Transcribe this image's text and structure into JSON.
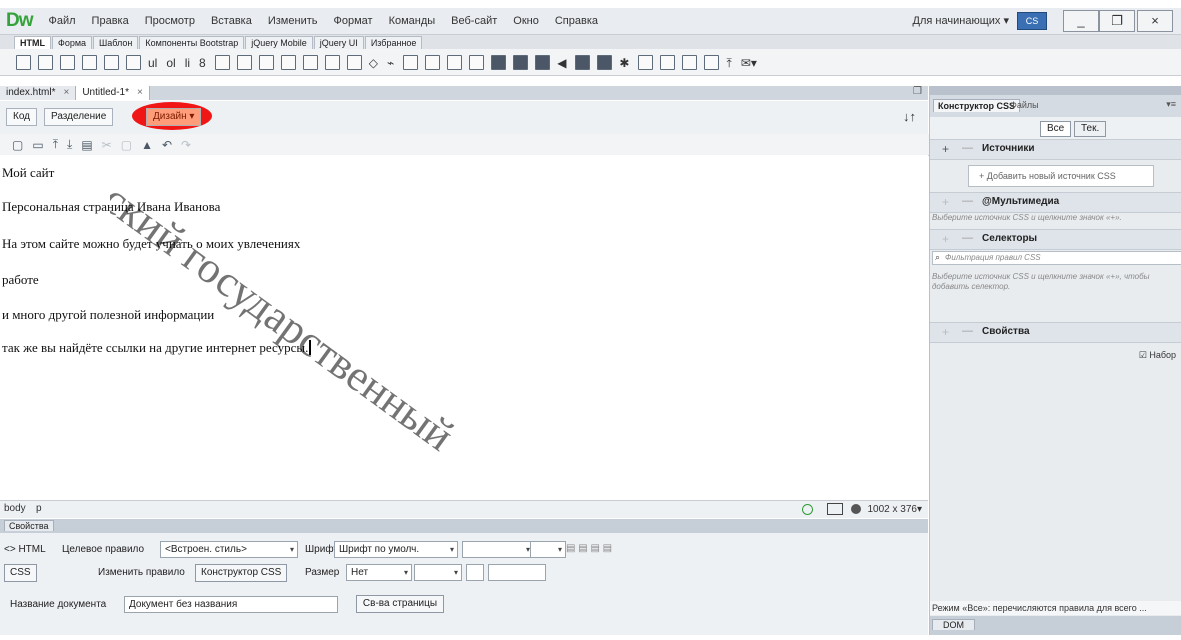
{
  "app": {
    "logo": "Dw",
    "menus": [
      "Файл",
      "Правка",
      "Просмотр",
      "Вставка",
      "Изменить",
      "Формат",
      "Команды",
      "Веб-сайт",
      "Окно",
      "Справка"
    ],
    "workspace": "Для начинающих",
    "cs_label": "CS",
    "window_buttons": [
      "_",
      "ð",
      "×"
    ]
  },
  "insert_tabs": [
    "HTML",
    "Форма",
    "Шаблон",
    "Компоненты Bootstrap",
    "jQuery Mobile",
    "jQuery UI",
    "Избранное"
  ],
  "document_tabs": [
    {
      "label": "index.html*",
      "close": "×"
    },
    {
      "label": "Untitled-1*",
      "close": "×"
    }
  ],
  "view_buttons": {
    "code": "Код",
    "split": "Разделение",
    "design": "Дизайн"
  },
  "canvas_lines": [
    "Мой сайт",
    "Персональная страница Ивана Иванова",
    "На этом сайте можно будет учнать о моих увлечениях",
    "работе",
    "и много другой полезной информации",
    "так же вы найдёте ссылки на другие интернет ресурсы."
  ],
  "status": {
    "tags": [
      "body",
      "p"
    ],
    "size": "1002 x 376"
  },
  "properties": {
    "panel_title": "Свойства",
    "html_btn": "<> HTML",
    "css_btn": "CSS",
    "target_rule_label": "Целевое правило",
    "target_rule_value": "<Встроен. стиль>",
    "edit_rule": "Изменить правило",
    "css_designer": "Конструктор CSS",
    "font_label": "Шрифт",
    "font_value": "Шрифт по умолч.",
    "size_label": "Размер",
    "size_value": "Нет",
    "doc_title_label": "Название документа",
    "doc_title_value": "Документ без названия",
    "page_props": "Св-ва страницы"
  },
  "right_panel": {
    "tab_css": "Конструктор CSS",
    "tab_files": "Файлы",
    "btn_all": "Все",
    "btn_current": "Тек.",
    "sources": "Источники",
    "add_source": "+ Добавить новый источник CSS",
    "media": "@Мультимедиа",
    "media_hint": "Выберите источник CSS и щелкните значок «+».",
    "selectors": "Селекторы",
    "filter_placeholder": "Фильтрация правил CSS",
    "selectors_hint": "Выберите источник CSS и щелкните значок «+», чтобы добавить селектор.",
    "properties": "Свойства",
    "set_label": "Набор",
    "bottom_message": "Режим «Все»: перечисляются правила для всего ...",
    "dom_tab": "DOM"
  },
  "watermark": "Уральский государственный"
}
